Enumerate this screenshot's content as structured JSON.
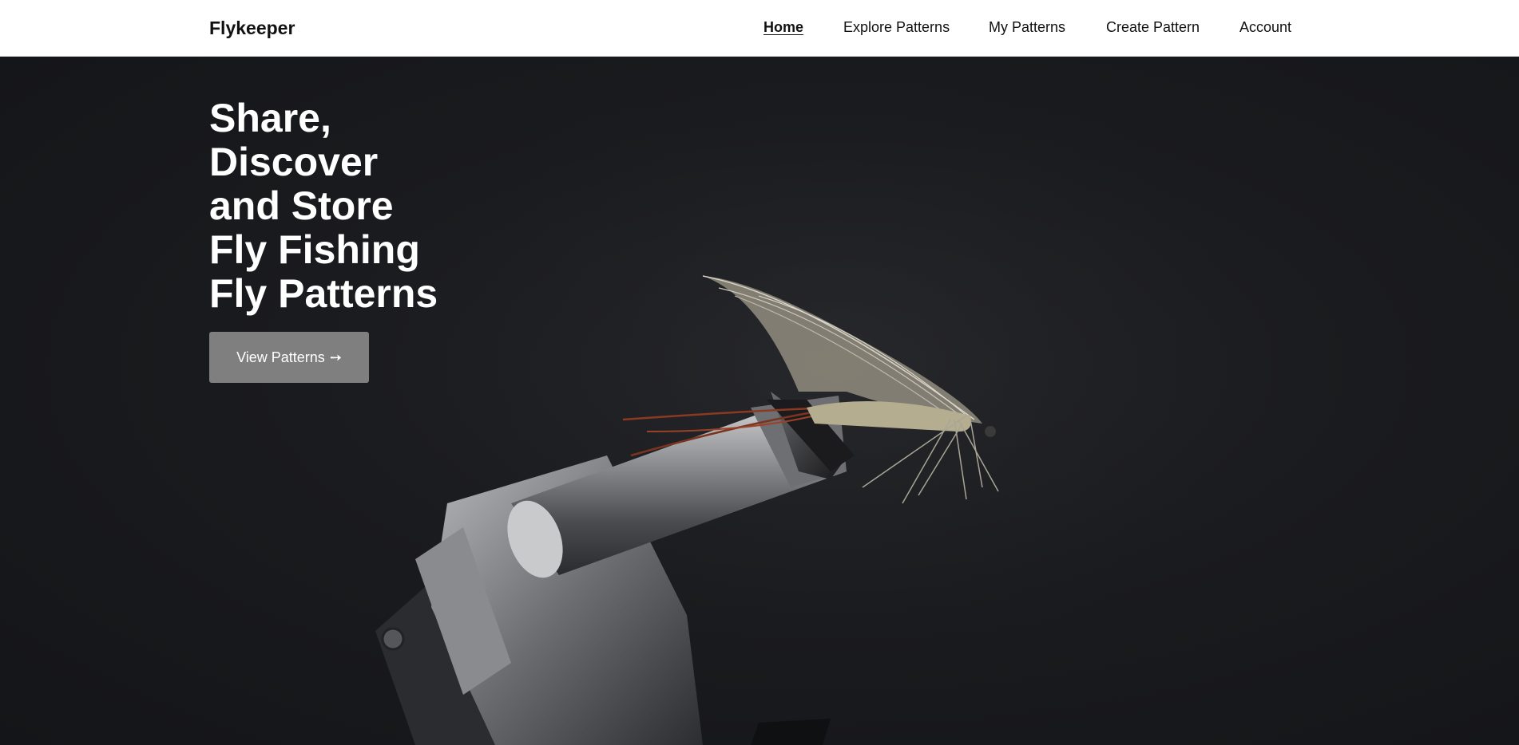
{
  "brand": {
    "name": "Flykeeper"
  },
  "nav": {
    "items": [
      {
        "label": "Home",
        "active": true
      },
      {
        "label": "Explore Patterns",
        "active": false
      },
      {
        "label": "My Patterns",
        "active": false
      },
      {
        "label": "Create Pattern",
        "active": false
      },
      {
        "label": "Account",
        "active": false
      }
    ]
  },
  "hero": {
    "title_lines": [
      "Share,",
      "Discover",
      "and Store",
      "Fly Fishing",
      "Fly Patterns"
    ],
    "cta": {
      "label": "View Patterns",
      "arrow": "➙",
      "arrow_icon": "arrow-right-icon"
    },
    "background_color": "#1a1b1e"
  },
  "colors": {
    "nav_bg": "#ffffff",
    "nav_text": "#111111",
    "hero_text": "#ffffff",
    "cta_bg": "#7f7f7f"
  }
}
